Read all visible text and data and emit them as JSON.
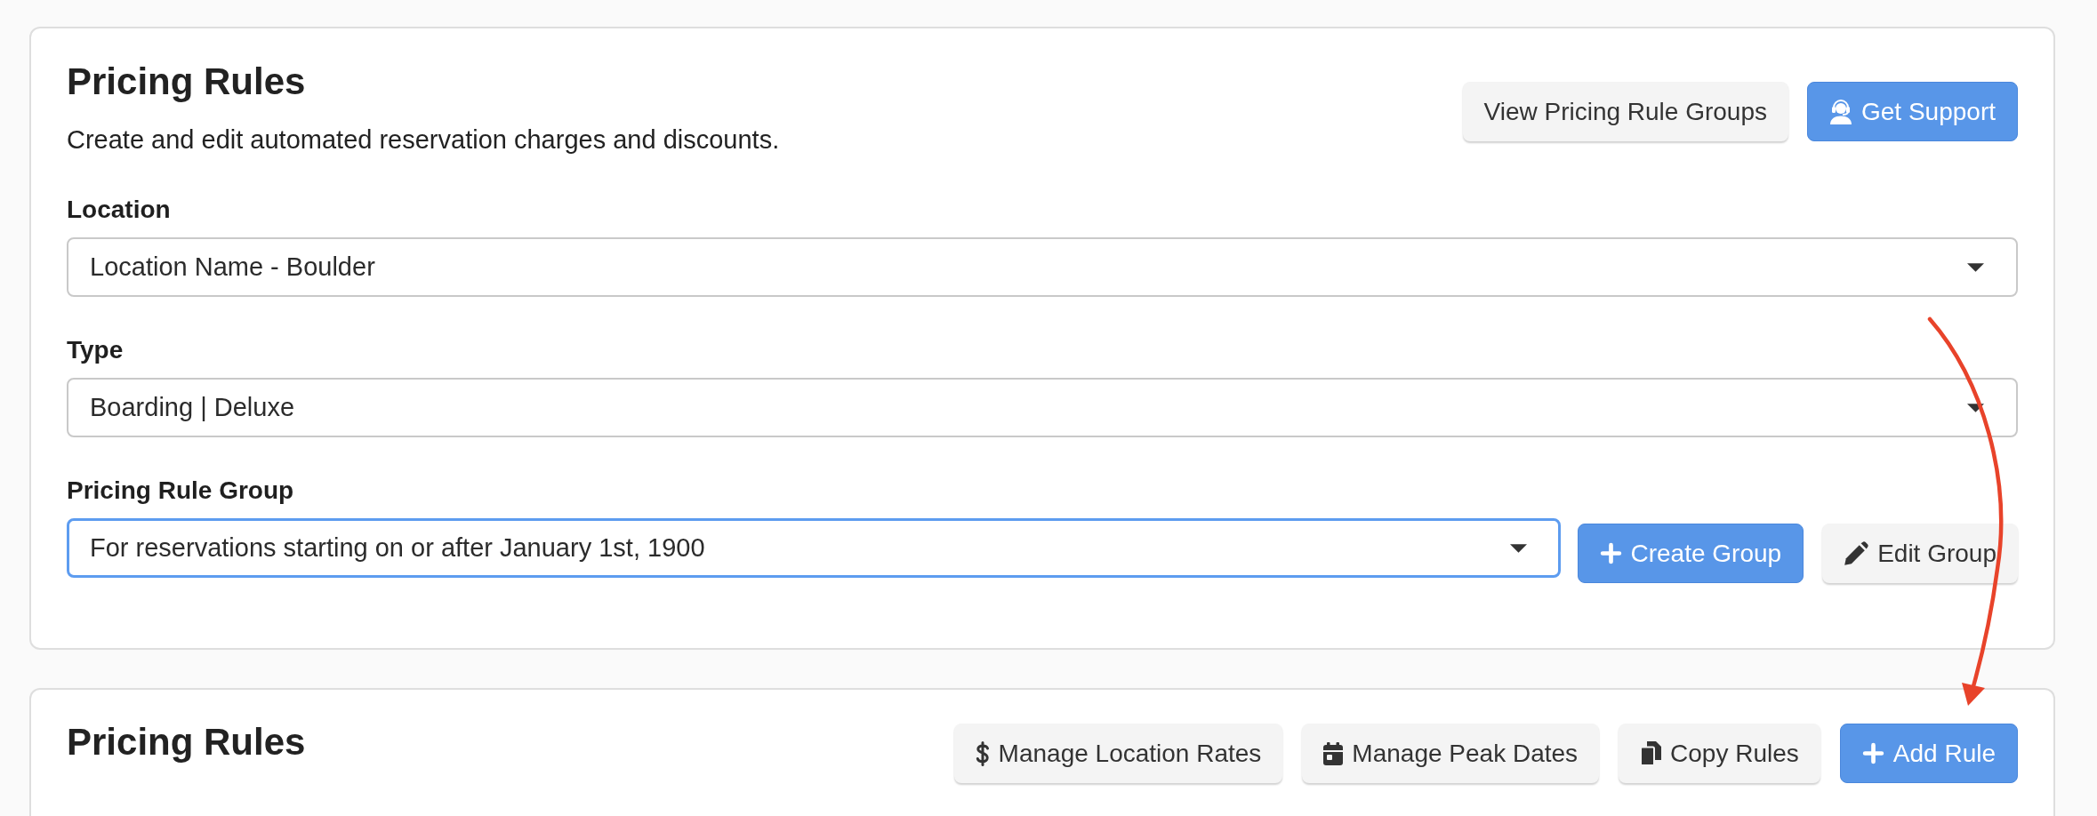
{
  "header": {
    "title": "Pricing Rules",
    "description": "Create and edit automated reservation charges and discounts.",
    "buttons": [
      {
        "label": "View Pricing Rule Groups",
        "kind": "groups",
        "primary": false
      },
      {
        "label": "Get Support",
        "kind": "support",
        "primary": true
      }
    ]
  },
  "fields": [
    {
      "label": "Location",
      "value": "Location Name - Boulder",
      "focused": false
    },
    {
      "label": "Type",
      "value": "Boarding | Deluxe",
      "focused": false
    },
    {
      "label": "Pricing Rule Group",
      "value": "For reservations starting on or after January 1st, 1900",
      "focused": true,
      "buttons": [
        {
          "label": "Create Group",
          "kind": "create",
          "primary": true
        },
        {
          "label": "Edit Group",
          "kind": "edit",
          "primary": false
        }
      ]
    }
  ],
  "rules_panel": {
    "title": "Pricing Rules",
    "buttons": [
      {
        "label": "Manage Location Rates",
        "kind": "rates",
        "primary": false
      },
      {
        "label": "Manage Peak Dates",
        "kind": "peak_dates",
        "primary": false
      },
      {
        "label": "Copy Rules",
        "kind": "copy",
        "primary": false
      },
      {
        "label": "Add Rule",
        "kind": "add",
        "primary": true
      }
    ]
  }
}
